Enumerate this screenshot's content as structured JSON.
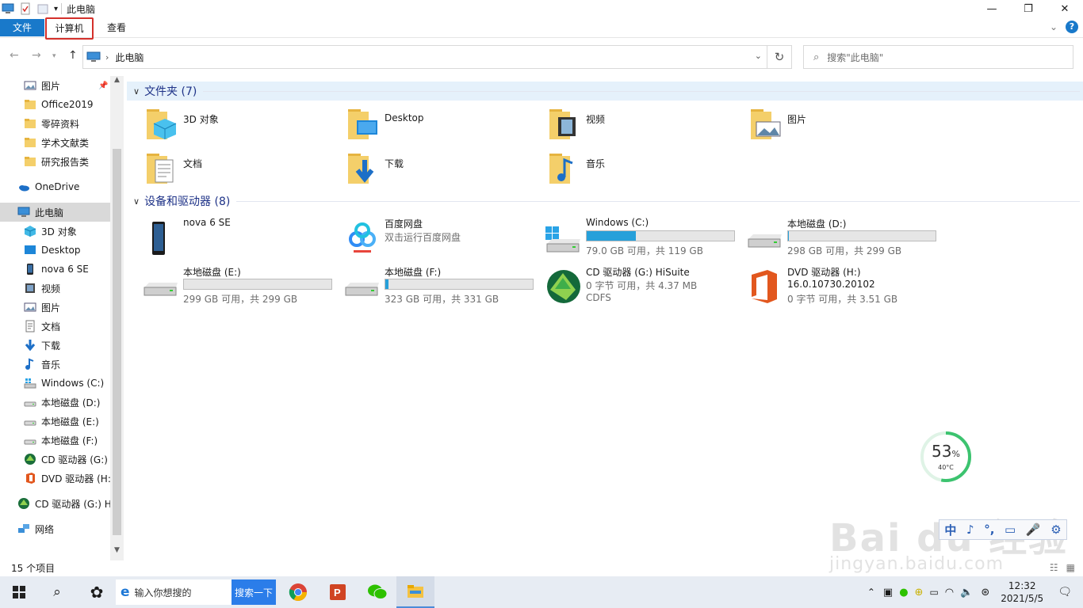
{
  "window": {
    "title": "此电脑",
    "minimize": "—",
    "maximize": "❐",
    "close": "✕"
  },
  "ribbon": {
    "file_tab": "文件",
    "computer_tab": "计算机",
    "view_tab": "查看",
    "expand": "⌄",
    "help": "?"
  },
  "address": {
    "path": "此电脑",
    "search_placeholder": "搜索\"此电脑\""
  },
  "navpane": {
    "items": [
      {
        "label": "图片",
        "icon": "pictures-icon"
      },
      {
        "label": "Office2019",
        "icon": "folder-icon"
      },
      {
        "label": "零碎资料",
        "icon": "folder-icon"
      },
      {
        "label": "学术文献类",
        "icon": "folder-icon"
      },
      {
        "label": "研究报告类",
        "icon": "folder-icon"
      },
      {
        "label": "OneDrive",
        "icon": "onedrive-icon"
      },
      {
        "label": "此电脑",
        "icon": "computer-icon"
      },
      {
        "label": "3D 对象",
        "icon": "3d-objects-icon"
      },
      {
        "label": "Desktop",
        "icon": "desktop-icon"
      },
      {
        "label": "nova 6 SE",
        "icon": "phone-icon"
      },
      {
        "label": "视频",
        "icon": "videos-icon"
      },
      {
        "label": "图片",
        "icon": "pictures-icon"
      },
      {
        "label": "文档",
        "icon": "documents-icon"
      },
      {
        "label": "下载",
        "icon": "downloads-icon"
      },
      {
        "label": "音乐",
        "icon": "music-icon"
      },
      {
        "label": "Windows (C:)",
        "icon": "windows-drive-icon"
      },
      {
        "label": "本地磁盘 (D:)",
        "icon": "drive-icon"
      },
      {
        "label": "本地磁盘 (E:)",
        "icon": "drive-icon"
      },
      {
        "label": "本地磁盘 (F:)",
        "icon": "drive-icon"
      },
      {
        "label": "CD 驱动器 (G:)",
        "icon": "hisuite-icon"
      },
      {
        "label": "DVD 驱动器 (H:",
        "icon": "office-icon"
      },
      {
        "label": "CD 驱动器 (G:) H",
        "icon": "hisuite-icon"
      },
      {
        "label": "网络",
        "icon": "network-icon"
      }
    ]
  },
  "groups": {
    "folders_header": "文件夹 (7)",
    "devices_header": "设备和驱动器 (8)"
  },
  "folders": [
    {
      "name": "3D 对象",
      "icon": "3d-objects-folder-icon"
    },
    {
      "name": "Desktop",
      "icon": "desktop-folder-icon"
    },
    {
      "name": "视频",
      "icon": "videos-folder-icon"
    },
    {
      "name": "图片",
      "icon": "pictures-folder-icon"
    },
    {
      "name": "文档",
      "icon": "documents-folder-icon"
    },
    {
      "name": "下载",
      "icon": "downloads-folder-icon"
    },
    {
      "name": "音乐",
      "icon": "music-folder-icon"
    }
  ],
  "drives": [
    {
      "name": "nova 6 SE",
      "line2": "",
      "line3": "",
      "usage": null,
      "icon": "phone-icon"
    },
    {
      "name": "百度网盘",
      "line2": "双击运行百度网盘",
      "line3": "",
      "usage": null,
      "icon": "baidu-netdisk-icon"
    },
    {
      "name": "Windows (C:)",
      "line2": "79.0 GB 可用，共 119 GB",
      "line3": "",
      "usage": 0.336,
      "icon": "windows-drive-icon"
    },
    {
      "name": "本地磁盘 (D:)",
      "line2": "298 GB 可用，共 299 GB",
      "line3": "",
      "usage": 0.003,
      "icon": "drive-icon"
    },
    {
      "name": "本地磁盘 (E:)",
      "line2": "299 GB 可用，共 299 GB",
      "line3": "",
      "usage": 0.0,
      "icon": "drive-icon"
    },
    {
      "name": "本地磁盘 (F:)",
      "line2": "323 GB 可用，共 331 GB",
      "line3": "",
      "usage": 0.024,
      "icon": "drive-icon"
    },
    {
      "name": "CD 驱动器 (G:) HiSuite",
      "line2": "0 字节 可用，共 4.37 MB",
      "line3": "CDFS",
      "usage": null,
      "icon": "hisuite-icon"
    },
    {
      "name": "DVD 驱动器 (H:)",
      "line2": "16.0.10730.20102",
      "line3": "0 字节 可用，共 3.51 GB",
      "usage": null,
      "icon": "office-icon"
    }
  ],
  "status": {
    "item_count": "15 个项目"
  },
  "widget": {
    "percent": "53",
    "percent_sign": "%",
    "temp": "40°C"
  },
  "ime": {
    "chars": [
      "中",
      "♪",
      "°,",
      "▭",
      "🎤",
      "⚙"
    ]
  },
  "watermark": {
    "logo": "Bai du 经验",
    "url": "jingyan.baidu.com"
  },
  "taskbar": {
    "search_placeholder": "输入你想搜的",
    "search_button": "搜索一下",
    "time": "12:32",
    "date": "2021/5/5"
  },
  "colors": {
    "accent": "#1979ca",
    "drive_fill": "#26a0da",
    "highlight_border": "#d4302b",
    "header_text": "#1e3287"
  }
}
